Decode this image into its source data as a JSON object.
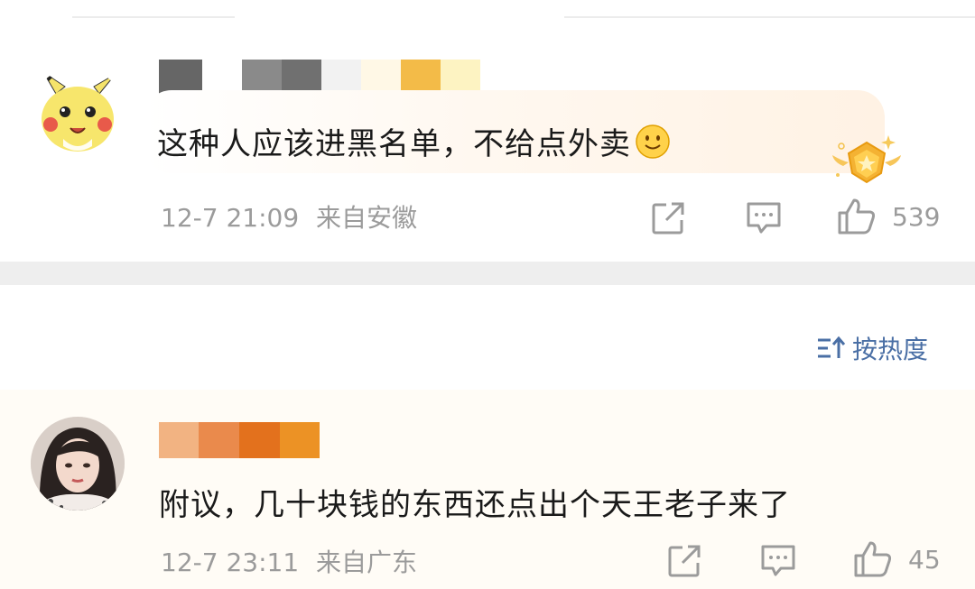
{
  "comments": [
    {
      "text": "这种人应该进黑名单，不给点外卖",
      "emoji": "smiley-emoji",
      "time": "12-7 21:09",
      "location": "来自安徽",
      "likes": "539",
      "badge": "star-badge-icon",
      "name_colors": [
        "#666666",
        "#ffffff",
        "#8a8a8a",
        "#707070",
        "#f2f2f2",
        "#fff8e6",
        "#f3bb48",
        "#fdf3c2"
      ]
    },
    {
      "text": "附议，几十块钱的东西还点出个天王老子来了",
      "time": "12-7 23:11",
      "location": "来自广东",
      "likes": "45",
      "name_colors": [
        "#f2b382",
        "#ea8a4c",
        "#e3711d",
        "#ec9225"
      ]
    }
  ],
  "sort": {
    "label": "按热度",
    "icon": "sort-icon"
  },
  "colors": {
    "accent_blue": "#4a6fa5",
    "meta_gray": "#9b9b9b",
    "separator": "#eeeeee"
  }
}
